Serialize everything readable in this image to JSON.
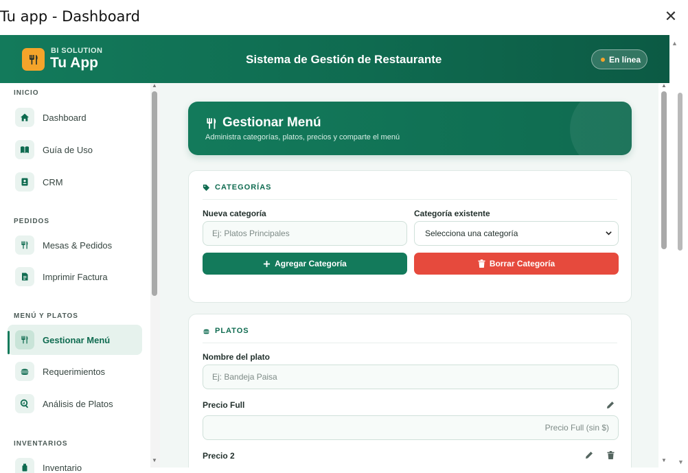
{
  "window": {
    "title": "Tu app - Dashboard",
    "close_icon": "close-icon"
  },
  "header": {
    "brand_top": "BI SOLUTION",
    "brand_name": "Tu App",
    "title": "Sistema de Gestión de Restaurante",
    "status": "En línea",
    "colors": {
      "primary": "#137a5b",
      "accent": "#f4a42a",
      "danger": "#e64a3d"
    }
  },
  "sidebar": {
    "sections": [
      {
        "label": "INICIO",
        "items": [
          {
            "label": "Dashboard",
            "icon": "home-icon"
          },
          {
            "label": "Guía de Uso",
            "icon": "book-icon"
          },
          {
            "label": "CRM",
            "icon": "contact-card-icon"
          }
        ]
      },
      {
        "label": "PEDIDOS",
        "items": [
          {
            "label": "Mesas & Pedidos",
            "icon": "utensils-icon"
          },
          {
            "label": "Imprimir Factura",
            "icon": "receipt-icon"
          }
        ]
      },
      {
        "label": "MENÚ Y PLATOS",
        "items": [
          {
            "label": "Gestionar Menú",
            "icon": "utensils-icon",
            "active": true
          },
          {
            "label": "Requerimientos",
            "icon": "burger-icon"
          },
          {
            "label": "Análisis de Platos",
            "icon": "magnify-chart-icon"
          }
        ]
      },
      {
        "label": "INVENTARIOS",
        "items": [
          {
            "label": "Inventario",
            "icon": "box-icon"
          }
        ]
      }
    ]
  },
  "hero": {
    "title": "Gestionar Menú",
    "subtitle": "Administra categorías, platos, precios y comparte el menú"
  },
  "categorias": {
    "heading": "CATEGORÍAS",
    "new_label": "Nueva categoría",
    "new_placeholder": "Ej: Platos Principales",
    "existing_label": "Categoría existente",
    "existing_selected": "Selecciona una categoría",
    "add_button": "Agregar Categoría",
    "delete_button": "Borrar Categoría"
  },
  "platos": {
    "heading": "PLATOS",
    "name_label": "Nombre del plato",
    "name_placeholder": "Ej: Bandeja Paisa",
    "price_full_label": "Precio Full",
    "price_full_placeholder": "Precio Full (sin $)",
    "price2_label": "Precio 2"
  }
}
